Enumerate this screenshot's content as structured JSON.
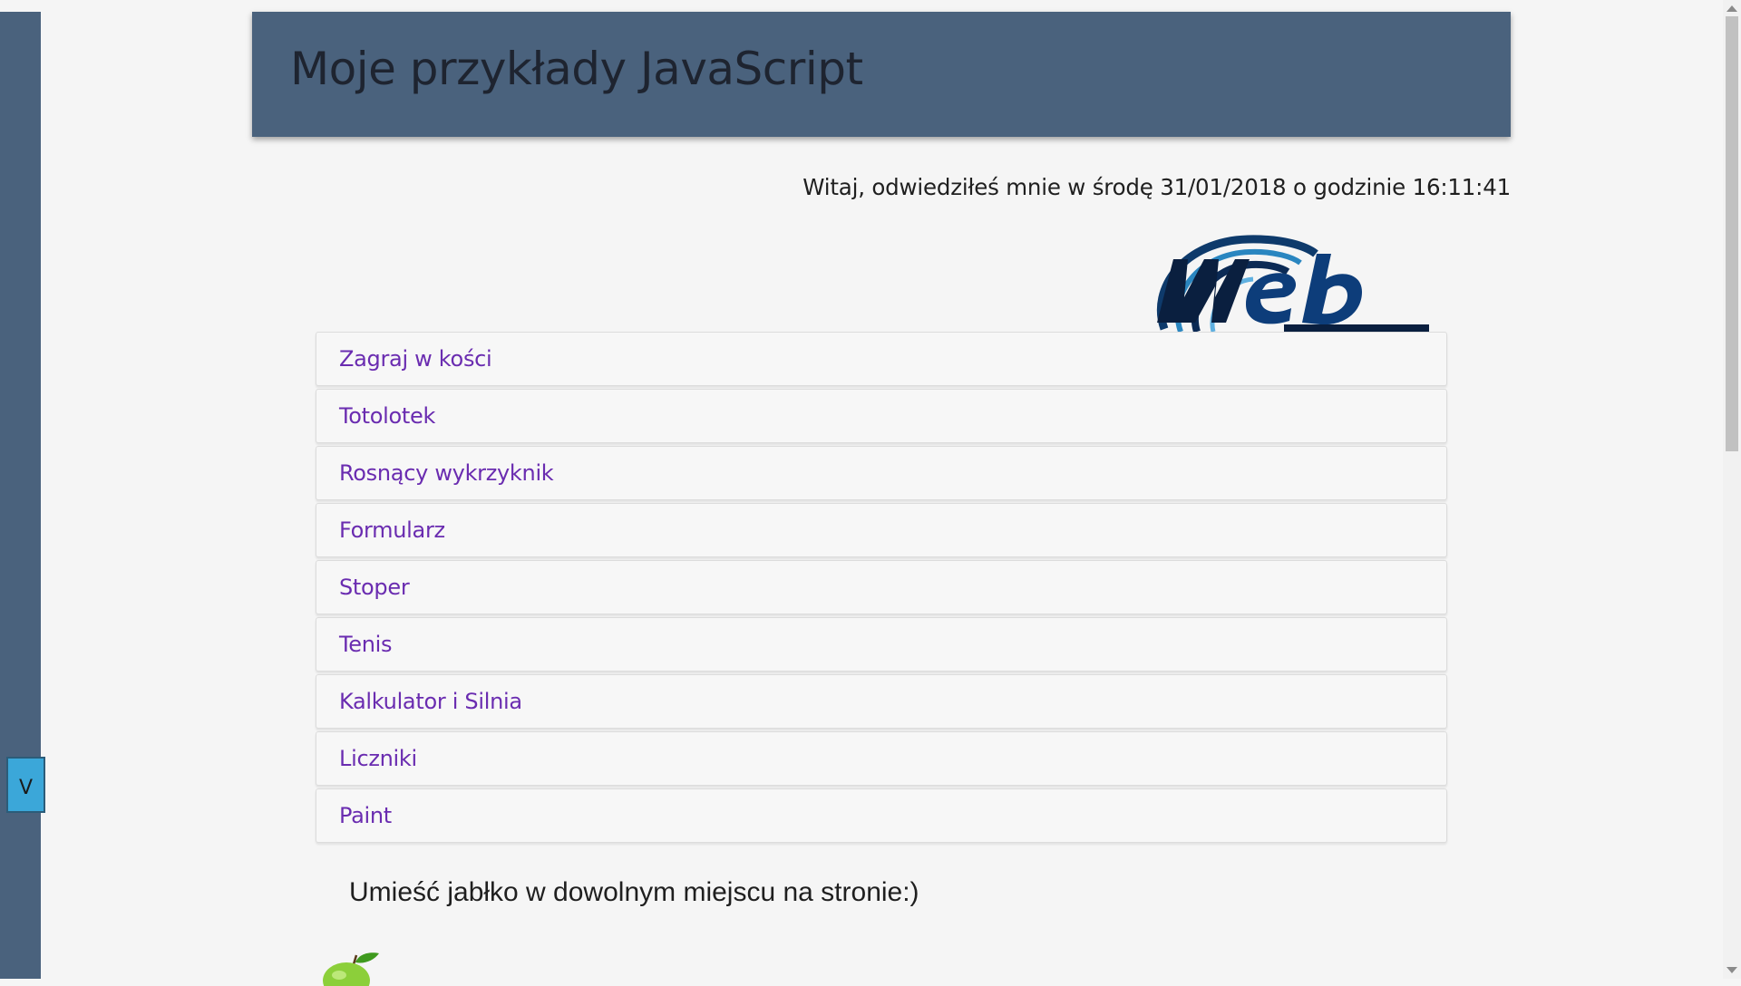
{
  "header": {
    "title": "Moje przykłady JavaScript"
  },
  "greeting": "Witaj, odwiedziłeś mnie w środę 31/01/2018 o godzinie 16:11:41",
  "toggle": {
    "label": "V"
  },
  "menu": {
    "items": [
      {
        "label": "Zagraj w kości"
      },
      {
        "label": "Totolotek"
      },
      {
        "label": "Rosnący wykrzyknik"
      },
      {
        "label": "Formularz"
      },
      {
        "label": "Stoper"
      },
      {
        "label": "Tenis"
      },
      {
        "label": "Kalkulator i Silnia"
      },
      {
        "label": "Liczniki"
      },
      {
        "label": "Paint"
      }
    ]
  },
  "hint": "Umieść jabłko w dowolnym miejscu na stronie:)",
  "logo": {
    "icon": "web-design-logo",
    "text": "web design"
  },
  "apple": {
    "icon": "apple-icon"
  },
  "colors": {
    "header_bg": "#4a627d",
    "link": "#6a2cb0",
    "toggle_bg": "#3ba7d9",
    "page_bg": "#f5f5f5"
  }
}
